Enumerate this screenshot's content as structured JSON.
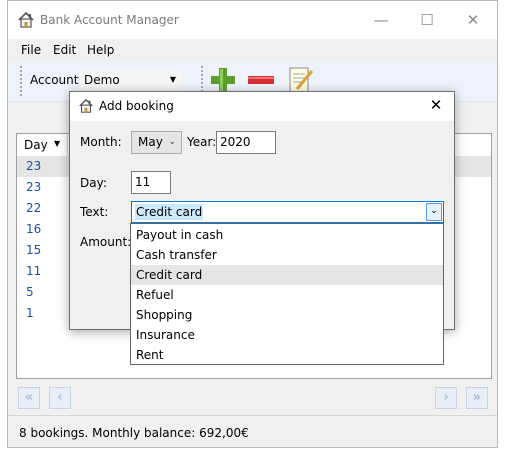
{
  "window": {
    "title": "Bank Account Manager",
    "controls": {
      "minimize": "—",
      "maximize": "☐",
      "close": "✕"
    }
  },
  "menu": {
    "items": [
      "File",
      "Edit",
      "Help"
    ]
  },
  "toolbar": {
    "account_label": "Account:",
    "account_value": "Demo",
    "buttons": [
      {
        "name": "add-booking",
        "icon": "plus-icon",
        "color": "#5aa02c"
      },
      {
        "name": "remove-booking",
        "icon": "minus-icon",
        "color": "#d62f2f"
      },
      {
        "name": "edit-booking",
        "icon": "notepad-pencil-icon"
      }
    ]
  },
  "grid": {
    "column_day": "Day",
    "rows": [
      "23",
      "23",
      "22",
      "16",
      "15",
      "11",
      "5",
      "1"
    ],
    "selected_index": 0
  },
  "pager": {
    "first": "«",
    "prev": "‹",
    "next": "›",
    "last": "»"
  },
  "status": {
    "text": "8 bookings. Monthly balance: 692,00€"
  },
  "dialog": {
    "title": "Add booking",
    "month_label": "Month:",
    "month_value": "May",
    "year_label": "Year:",
    "year_value": "2020",
    "day_label": "Day:",
    "day_value": "11",
    "text_label": "Text:",
    "text_value": "Credit card",
    "amount_label": "Amount:",
    "options": [
      "Payout in cash",
      "Cash transfer",
      "Credit card",
      "Refuel",
      "Shopping",
      "Insurance",
      "Rent"
    ],
    "selected_option": 2
  },
  "colors": {
    "accent": "#0078d7",
    "selection": "#cce8ff",
    "link_text": "#1a4fa8"
  }
}
